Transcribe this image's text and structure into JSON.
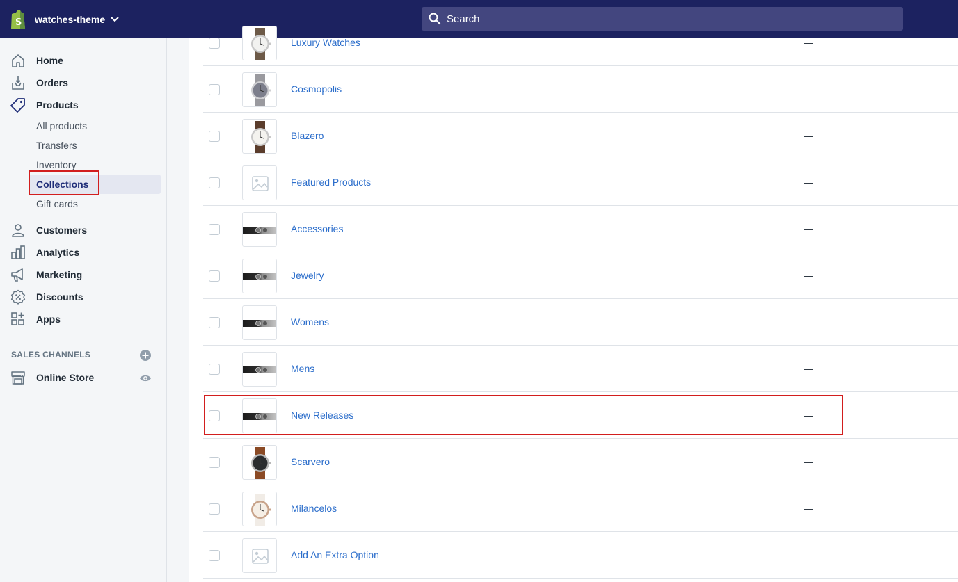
{
  "store": {
    "name": "watches-theme"
  },
  "search": {
    "placeholder": "Search"
  },
  "nav": {
    "home": "Home",
    "orders": "Orders",
    "products": "Products",
    "products_sub": {
      "all_products": "All products",
      "transfers": "Transfers",
      "inventory": "Inventory",
      "collections": "Collections",
      "gift_cards": "Gift cards"
    },
    "customers": "Customers",
    "analytics": "Analytics",
    "marketing": "Marketing",
    "discounts": "Discounts",
    "apps": "Apps"
  },
  "sales_channels": {
    "title": "SALES CHANNELS",
    "online_store": "Online Store"
  },
  "collections": [
    {
      "title": "Luxury Watches",
      "conditions": "—",
      "thumb": "watch-silver"
    },
    {
      "title": "Cosmopolis",
      "conditions": "—",
      "thumb": "watch-grey"
    },
    {
      "title": "Blazero",
      "conditions": "—",
      "thumb": "watch-brown"
    },
    {
      "title": "Featured Products",
      "conditions": "—",
      "thumb": "image-placeholder"
    },
    {
      "title": "Accessories",
      "conditions": "—",
      "thumb": "banner"
    },
    {
      "title": "Jewelry",
      "conditions": "—",
      "thumb": "banner"
    },
    {
      "title": "Womens",
      "conditions": "—",
      "thumb": "banner"
    },
    {
      "title": "Mens",
      "conditions": "—",
      "thumb": "banner"
    },
    {
      "title": "New Releases",
      "conditions": "—",
      "thumb": "banner"
    },
    {
      "title": "Scarvero",
      "conditions": "—",
      "thumb": "watch-black"
    },
    {
      "title": "Milancelos",
      "conditions": "—",
      "thumb": "watch-rose"
    },
    {
      "title": "Add An Extra Option",
      "conditions": "—",
      "thumb": "image-placeholder"
    }
  ],
  "colors": {
    "topbar": "#1c2260",
    "search_bg": "#43467f",
    "link": "#2c6ecb",
    "highlight": "#d21e1e",
    "active_nav_bg": "#e4e7f1"
  }
}
